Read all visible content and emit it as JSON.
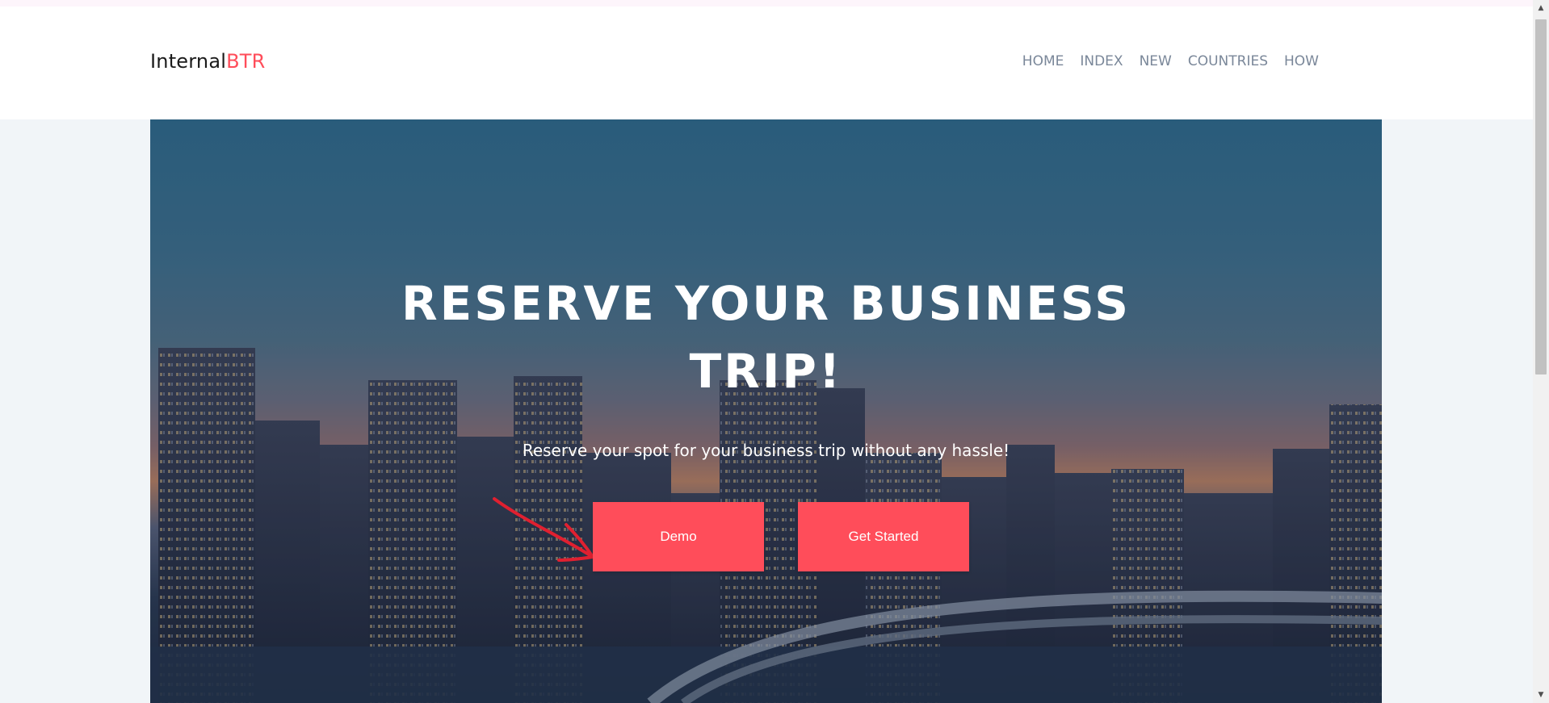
{
  "brand": {
    "prefix": "Internal",
    "accent": "BTR"
  },
  "nav": {
    "items": [
      {
        "label": "HOME"
      },
      {
        "label": "INDEX"
      },
      {
        "label": "NEW"
      },
      {
        "label": "COUNTRIES"
      },
      {
        "label": "HOW"
      }
    ]
  },
  "hero": {
    "title_line1": "RESERVE YOUR BUSINESS",
    "title_line2": "TRIP!",
    "subtitle": "Reserve your spot for your business trip without any hassle!",
    "background_image": "city-skyline-dusk"
  },
  "buttons": {
    "demo_label": "Demo",
    "start_label": "Get Started"
  },
  "annotation": {
    "icon": "red-arrow-icon"
  },
  "colors": {
    "accent": "#ff4d5a",
    "nav_text": "#7a8799",
    "page_bg": "#f1f5f8"
  },
  "scrollbar": {
    "up_icon": "▲",
    "down_icon": "▼"
  }
}
